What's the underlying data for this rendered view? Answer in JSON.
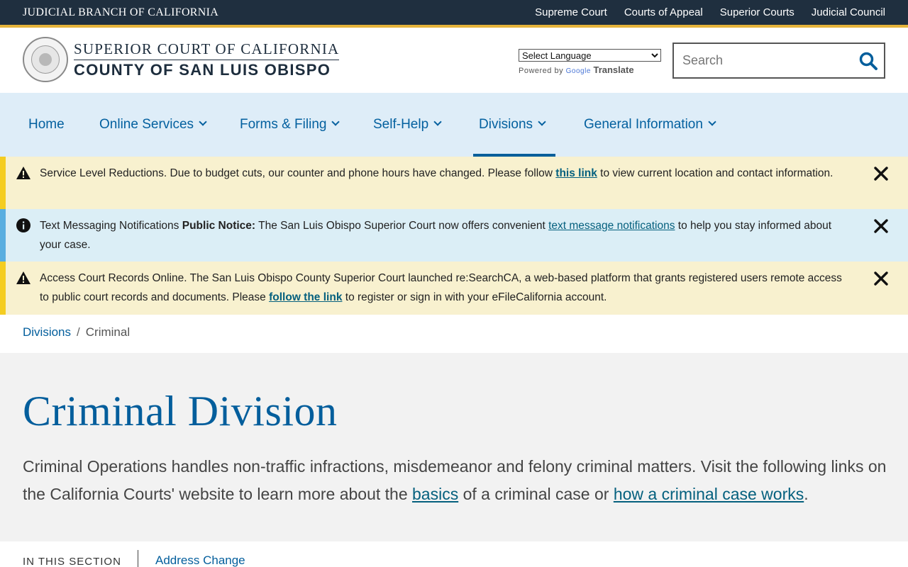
{
  "topbar": {
    "brand": "JUDICIAL BRANCH OF CALIFORNIA",
    "links": [
      "Supreme Court",
      "Courts of Appeal",
      "Superior Courts",
      "Judicial Council"
    ]
  },
  "header": {
    "title_top": "SUPERIOR COURT OF CALIFORNIA",
    "title_bottom": "COUNTY OF SAN LUIS OBISPO",
    "translate": {
      "select_value": "Select Language",
      "powered_by": "Powered by",
      "google": "Google",
      "translate_label": "Translate"
    },
    "search_placeholder": "Search"
  },
  "nav": {
    "items": [
      {
        "label": "Home"
      },
      {
        "label": "Online Services"
      },
      {
        "label": "Forms & Filing"
      },
      {
        "label": "Self-Help"
      },
      {
        "label": "Divisions"
      },
      {
        "label": "General Information"
      }
    ],
    "active": "Divisions"
  },
  "alerts": [
    {
      "type": "warning",
      "title": "Service Level Reductions.",
      "before": "Due to budget cuts, our counter and phone hours have changed. Please follow",
      "link": "this link",
      "after": "to view current location and contact information."
    },
    {
      "type": "info",
      "title": "Text Messaging Notifications",
      "bold": "Public Notice:",
      "before": "The San Luis Obispo Superior Court now offers convenient",
      "link": "text message notifications",
      "after": "to help you stay informed about your case."
    },
    {
      "type": "warning",
      "title": "Access Court Records Online.",
      "before": "The San Luis Obispo County Superior Court launched re:SearchCA, a web-based platform that grants registered users remote access to public court records and documents. Please",
      "link": "follow the link",
      "after": "to register or sign in with your eFileCalifornia account."
    }
  ],
  "breadcrumb": {
    "parent": "Divisions",
    "separator": "/",
    "current": "Criminal"
  },
  "hero": {
    "title": "Criminal Division",
    "intro_before": "Criminal Operations handles non-traffic infractions, misdemeanor and felony criminal matters. Visit the following links on the California Courts' website to learn more about the",
    "link1": "basics",
    "intro_middle": "of a criminal case or",
    "link2": "how a criminal case works",
    "intro_after": "."
  },
  "in_this_section": {
    "label": "IN THIS SECTION",
    "first_link": "Address Change"
  },
  "colors": {
    "topbar": "#1f2f3f",
    "gold": "#e5b33a",
    "nav_bg": "#deedf8",
    "link_blue": "#035e9c",
    "warning_bg": "#f8f1cf",
    "warning_stripe": "#f4cd21",
    "info_bg": "#dbeef6",
    "info_stripe": "#59aee0"
  },
  "icons": {
    "search": "search-icon",
    "warning": "warning-icon",
    "info": "info-icon",
    "close": "close-icon",
    "chevron": "chevron-down-icon",
    "seal": "court-seal-logo"
  }
}
